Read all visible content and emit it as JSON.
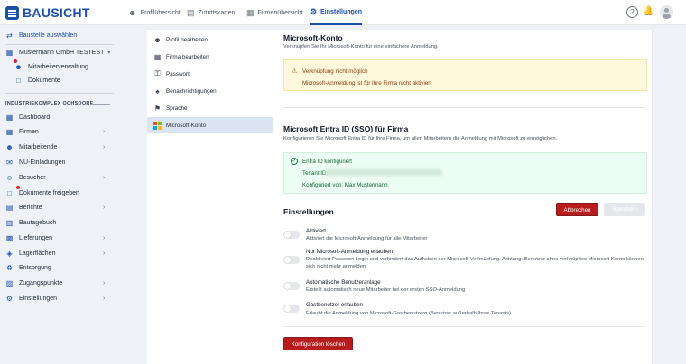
{
  "app": {
    "logo_text": "BAUSICHT"
  },
  "topnav": [
    {
      "label": "Profilübersicht",
      "icon": "person-icon"
    },
    {
      "label": "Zutrittskarten",
      "icon": "card-icon"
    },
    {
      "label": "Firmenübersicht",
      "icon": "building-icon"
    },
    {
      "label": "Einstellungen",
      "icon": "gear-icon",
      "active": true
    }
  ],
  "sidebar": {
    "select_site": "Baustelle auswählen",
    "company": "Mustermann GmbH TESTEST",
    "company_sub": [
      "Mitarbeiterverwaltung",
      "Dokumente"
    ],
    "group_label": "INDUSTRIEKOMPLEX OCHSDORF",
    "items": [
      "Dashboard",
      "Firmen",
      "Mitarbeitende",
      "NU-Einladungen",
      "Besucher",
      "Dokumente freigeben",
      "Berichte",
      "Bautagebuch",
      "Lieferungen",
      "Lagerflächen",
      "Entsorgung",
      "Zugangspunkte",
      "Einstellungen"
    ]
  },
  "settings_menu": [
    "Profil bearbeiten",
    "Firma bearbeiten",
    "Passwort",
    "Benachrichtigungen",
    "Sprache",
    "Microsoft-Konto"
  ],
  "microsoft": {
    "title": "Microsoft-Konto",
    "subtitle": "Verknüpfen Sie Ihr Microsoft-Konto für eine einfachere Anmeldung.",
    "warn_title": "Verknüpfung nicht möglich",
    "warn_text": "Microsoft-Anmeldung ist für Ihre Firma nicht aktiviert"
  },
  "sso": {
    "title": "Microsoft Entra ID (SSO) für Firma",
    "subtitle": "Konfigurieren Sie Microsoft Entra ID für Ihre Firma, um allen Mitarbeitern die Anmeldung mit Microsoft zu ermöglichen.",
    "status": "Entra ID konfiguriert",
    "tenant_label": "Tenant ID:",
    "configured_by": "Konfiguriert von: Max Mustermann"
  },
  "einstellungen": {
    "title": "Einstellungen",
    "cancel": "Abbrechen",
    "save": "Speichern",
    "options": [
      {
        "title": "Aktiviert",
        "desc": "Aktiviert die Microsoft-Anmeldung für alle Mitarbeiter",
        "on": false
      },
      {
        "title": "Nur Microsoft-Anmeldung erlauben",
        "desc": "Deaktiviert Passwort-Login und verhindert das Aufheben der Microsoft-Verknüpfung. Achtung: Benutzer ohne verknüpftes Microsoft-Konto können sich nicht mehr anmelden.",
        "on": false
      },
      {
        "title": "Automatische Benutzeranlage",
        "desc": "Erstellt automatisch neue Mitarbeiter bei der ersten SSO-Anmeldung",
        "on": false
      },
      {
        "title": "Gastbenutzer erlauben",
        "desc": "Erlaubt die Anmeldung von Microsoft-Gastbenutzern (Benutzer außerhalb Ihres Tenants)",
        "on": false
      }
    ],
    "delete": "Konfiguration löschen"
  },
  "colors": {
    "brand": "#1d4fa8",
    "danger": "#b91c1c",
    "warn_bg": "#fdf7dc",
    "ok_bg": "#ecfdf3"
  }
}
